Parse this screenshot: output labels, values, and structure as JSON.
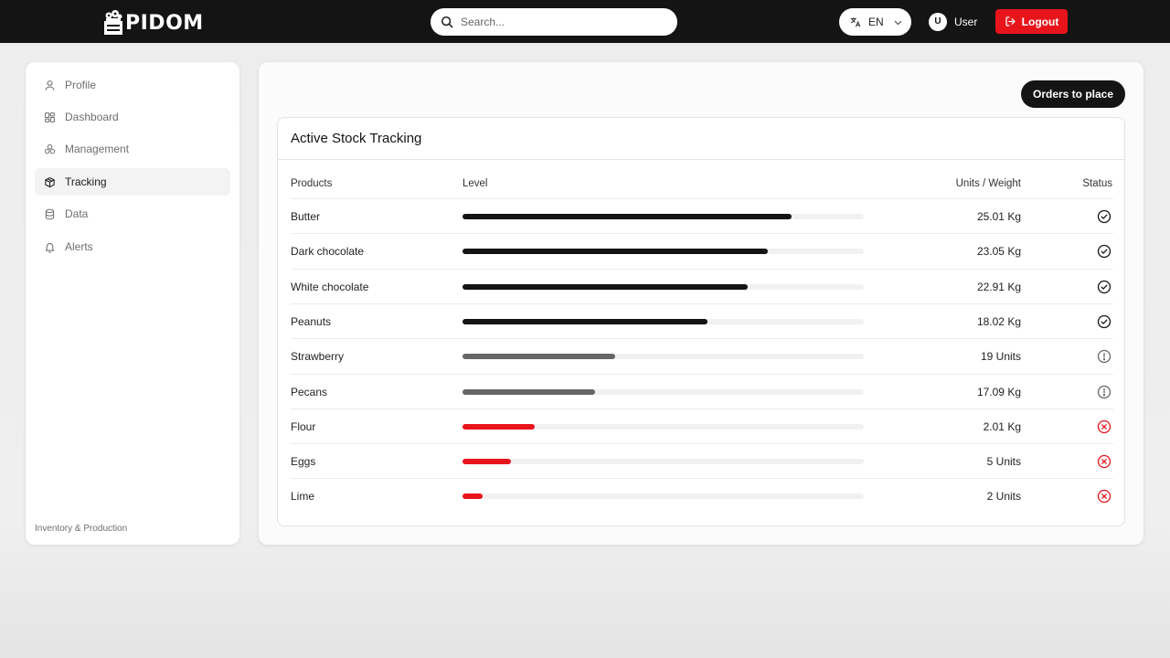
{
  "header": {
    "brand": "PIDOM",
    "search_placeholder": "Search...",
    "language": "EN",
    "user_initial": "U",
    "user_name": "User",
    "logout_label": "Logout",
    "logout_color": "#e8141c"
  },
  "sidebar": {
    "items": [
      {
        "label": "Profile",
        "icon": "user-icon",
        "active": false
      },
      {
        "label": "Dashboard",
        "icon": "dashboard-icon",
        "active": false
      },
      {
        "label": "Management",
        "icon": "boxes-icon",
        "active": false
      },
      {
        "label": "Tracking",
        "icon": "package-icon",
        "active": true
      },
      {
        "label": "Data",
        "icon": "database-icon",
        "active": false
      },
      {
        "label": "Alerts",
        "icon": "bell-icon",
        "active": false
      }
    ],
    "footer": "Inventory & Production"
  },
  "main": {
    "orders_button": "Orders to place",
    "panel_title": "Active Stock Tracking",
    "columns": [
      "Products",
      "Level",
      "Units / Weight",
      "Status"
    ],
    "rows": [
      {
        "product": "Butter",
        "level": 0.82,
        "units": "25.01 Kg",
        "status": "ok"
      },
      {
        "product": "Dark chocolate",
        "level": 0.76,
        "units": "23.05 Kg",
        "status": "ok"
      },
      {
        "product": "White chocolate",
        "level": 0.71,
        "units": "22.91 Kg",
        "status": "ok"
      },
      {
        "product": "Peanuts",
        "level": 0.61,
        "units": "18.02 Kg",
        "status": "ok"
      },
      {
        "product": "Strawberry",
        "level": 0.38,
        "units": "19 Units",
        "status": "warning"
      },
      {
        "product": "Pecans",
        "level": 0.33,
        "units": "17.09 Kg",
        "status": "warning"
      },
      {
        "product": "Flour",
        "level": 0.18,
        "units": "2.01 Kg",
        "status": "critical"
      },
      {
        "product": "Eggs",
        "level": 0.12,
        "units": "5 Units",
        "status": "critical"
      },
      {
        "product": "Lime",
        "level": 0.05,
        "units": "2 Units",
        "status": "critical"
      }
    ],
    "status_colors": {
      "ok": "#141414",
      "warning": "#666666",
      "critical": "#e8141c"
    }
  }
}
